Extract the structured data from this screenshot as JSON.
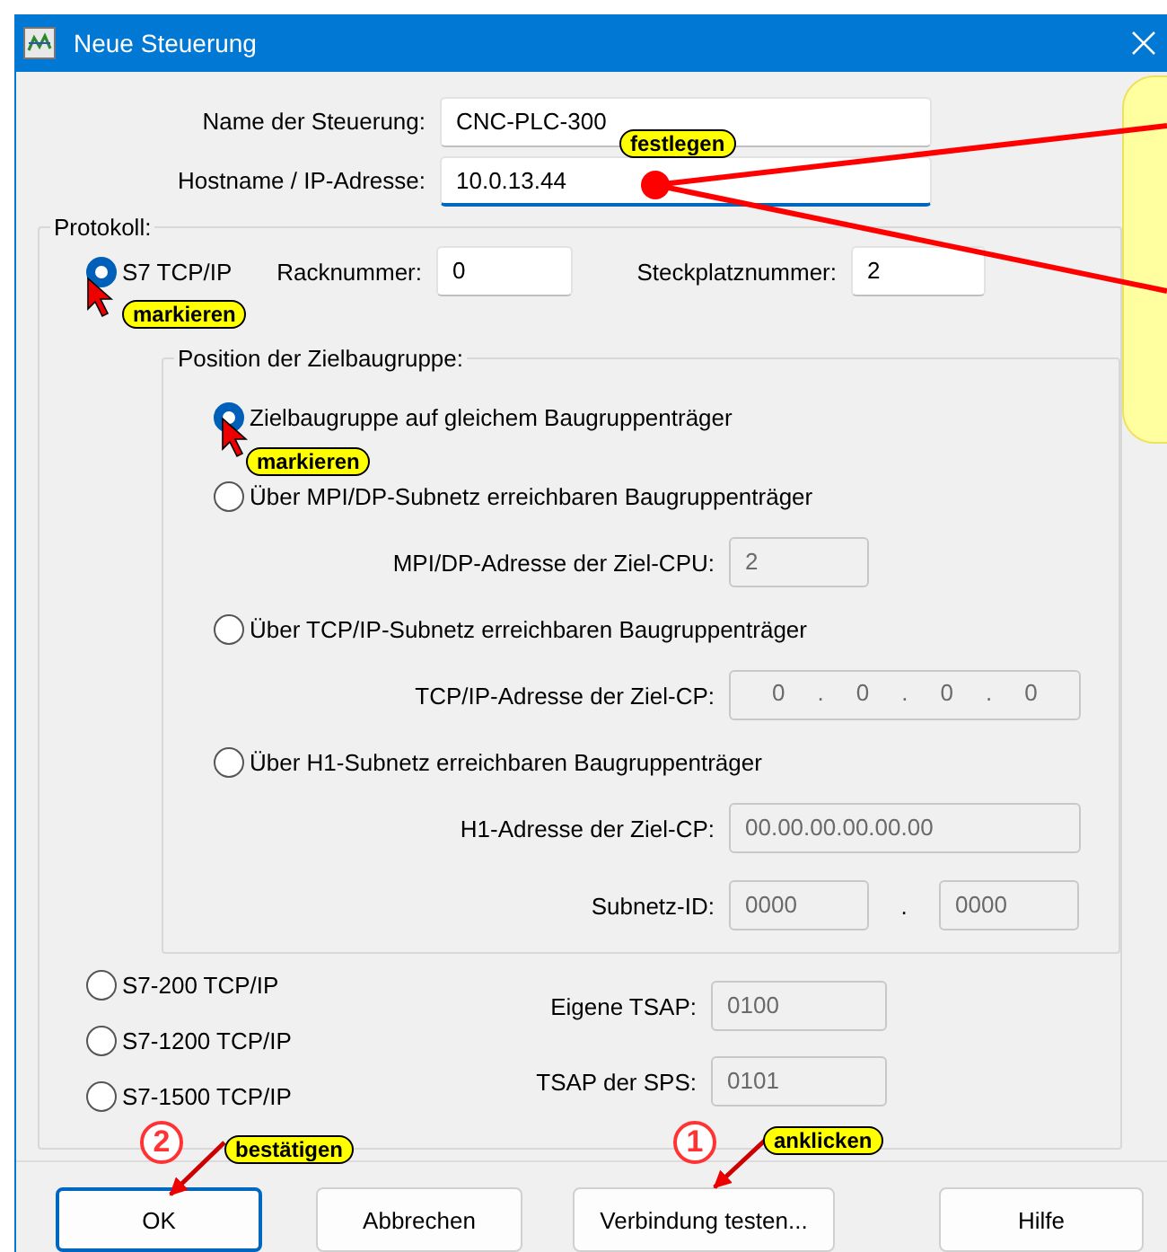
{
  "window": {
    "title": "Neue Steuerung"
  },
  "fields": [
    {
      "label": "Name der Steuerung:",
      "value": "CNC-PLC-300",
      "focused": false
    },
    {
      "label": "Hostname / IP-Adresse:",
      "value": "10.0.13.44",
      "focused": true
    }
  ],
  "protocol": {
    "title": "Protokoll:",
    "main": {
      "label": "S7 TCP/IP",
      "selected": true,
      "rack_label": "Racknummer:",
      "rack": "0",
      "slot_label": "Steckplatznummer:",
      "slot": "2"
    },
    "position": {
      "title": "Position der Zielbaugruppe:",
      "options": [
        {
          "label": "Zielbaugruppe auf gleichem Baugruppenträger",
          "selected": true
        },
        {
          "label": "Über MPI/DP-Subnetz erreichbaren Baugruppenträger",
          "selected": false,
          "subfields": [
            {
              "label": "MPI/DP-Adresse der Ziel-CPU:",
              "kind": "short",
              "values": [
                "2"
              ],
              "disabled": true
            }
          ]
        },
        {
          "label": "Über TCP/IP-Subnetz erreichbaren Baugruppenträger",
          "selected": false,
          "subfields": [
            {
              "label": "TCP/IP-Adresse der Ziel-CP:",
              "kind": "ip",
              "values": [
                "0",
                ".",
                "0",
                ".",
                "0",
                ".",
                "0"
              ],
              "disabled": true
            }
          ]
        },
        {
          "label": "Über H1-Subnetz erreichbaren Baugruppenträger",
          "selected": false,
          "subfields": [
            {
              "label": "H1-Adresse der Ziel-CP:",
              "kind": "long",
              "values": [
                "00.00.00.00.00.00"
              ],
              "disabled": true
            },
            {
              "label": "Subnetz-ID:",
              "kind": "pair",
              "values": [
                "0000",
                ".",
                "0000"
              ],
              "disabled": true
            }
          ]
        }
      ]
    },
    "others": [
      {
        "label": "S7-200 TCP/IP",
        "selected": false
      },
      {
        "label": "S7-1200 TCP/IP",
        "selected": false
      },
      {
        "label": "S7-1500 TCP/IP",
        "selected": false
      }
    ],
    "tsap": [
      {
        "label": "Eigene TSAP:",
        "value": "0100",
        "disabled": true
      },
      {
        "label": "TSAP der SPS:",
        "value": "0101",
        "disabled": true
      }
    ]
  },
  "buttons": [
    {
      "label": "OK",
      "default": true
    },
    {
      "label": "Abbrechen",
      "default": false
    },
    {
      "label": "Verbindung testen...",
      "default": false
    },
    {
      "label": "Hilfe",
      "default": false
    }
  ],
  "annotations": {
    "badges": [
      "festlegen",
      "markieren",
      "markieren",
      "bestätigen",
      "anklicken"
    ],
    "steps": [
      "2",
      "1"
    ]
  }
}
